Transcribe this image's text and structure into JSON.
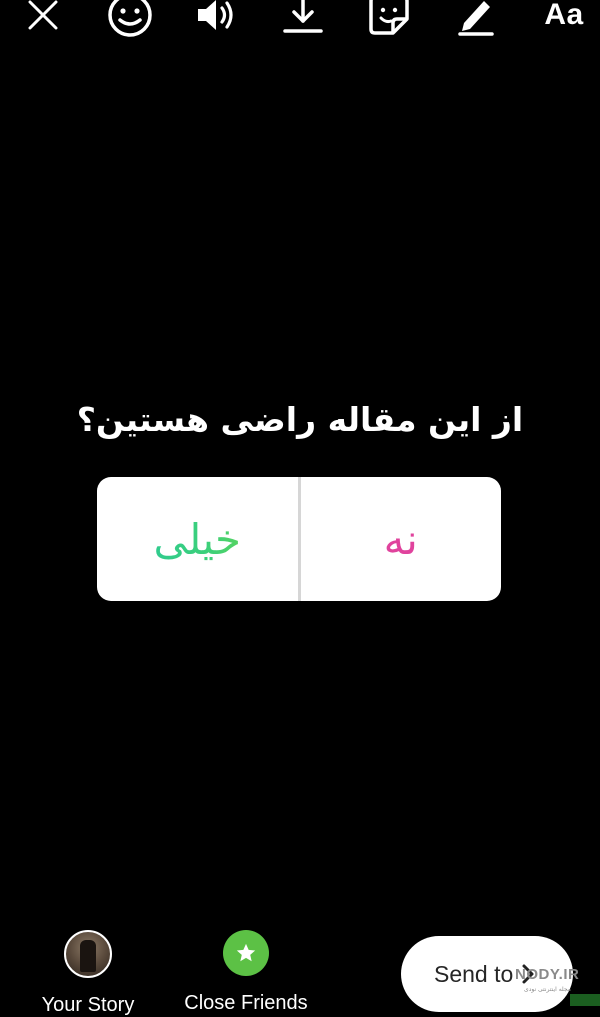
{
  "toolbar": {
    "items": [
      {
        "name": "close",
        "icon": "close-icon"
      },
      {
        "name": "face-filters",
        "icon": "face-icon"
      },
      {
        "name": "sound",
        "icon": "speaker-icon"
      },
      {
        "name": "save",
        "icon": "download-icon"
      },
      {
        "name": "stickers",
        "icon": "sticker-icon"
      },
      {
        "name": "draw",
        "icon": "pen-icon"
      },
      {
        "name": "text",
        "icon": "text-icon"
      }
    ],
    "text_tool_label": "Aa"
  },
  "poll": {
    "question": "از این مقاله راضی هستین؟",
    "options": [
      {
        "label": "نه",
        "color": "#e0439d"
      },
      {
        "label": "خیلی",
        "gradient": [
          "#23c6a3",
          "#7fd836"
        ]
      }
    ]
  },
  "share": {
    "your_story_label": "Your Story",
    "close_friends_label": "Close Friends",
    "close_friends_color": "#5cc145",
    "send_label": "Send to"
  },
  "watermark": {
    "text": "NODY.IR",
    "subtext": "مجله اینترنتی نودی"
  },
  "colors": {
    "background": "#000000",
    "card": "#ffffff",
    "divider": "#d6d6d6"
  }
}
